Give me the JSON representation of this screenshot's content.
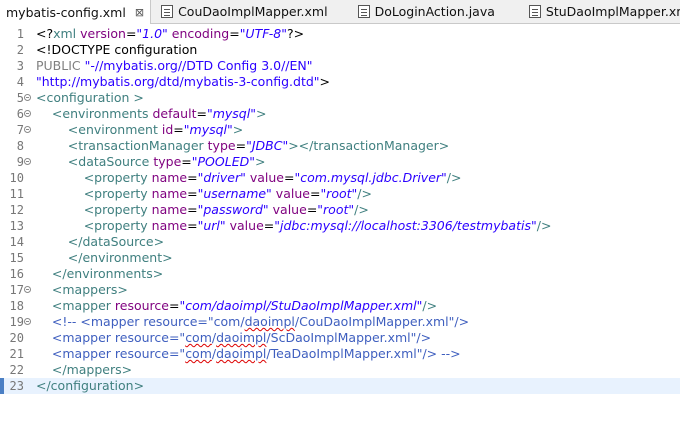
{
  "tabs": [
    {
      "label": "mybatis-config.xml",
      "close": "⊠",
      "active": true
    },
    {
      "label": "CouDaoImplMapper.xml"
    },
    {
      "label": "DoLoginAction.java"
    },
    {
      "label": "StuDaoImplMapper.xml"
    }
  ],
  "lines": [
    {
      "n": "1",
      "fold": false,
      "seg": [
        [
          "p",
          "<?"
        ],
        [
          "t",
          "xml"
        ],
        [
          "p",
          " "
        ],
        [
          "a",
          "version"
        ],
        [
          "p",
          "="
        ],
        [
          "v",
          "\"1.0\""
        ],
        [
          "p",
          " "
        ],
        [
          "a",
          "encoding"
        ],
        [
          "p",
          "="
        ],
        [
          "v",
          "\"UTF-8\""
        ],
        [
          "p",
          "?>"
        ]
      ]
    },
    {
      "n": "2",
      "fold": false,
      "seg": [
        [
          "p",
          "<!DOCTYPE configuration"
        ]
      ]
    },
    {
      "n": "3",
      "fold": false,
      "seg": [
        [
          "d",
          "PUBLIC "
        ],
        [
          "s",
          "\"-//mybatis.org//DTD Config 3.0//EN\""
        ]
      ]
    },
    {
      "n": "4",
      "fold": false,
      "seg": [
        [
          "s",
          "\"http://mybatis.org/dtd/mybatis-3-config.dtd\""
        ],
        [
          "p",
          ">"
        ]
      ]
    },
    {
      "n": "5",
      "fold": true,
      "seg": [
        [
          "t",
          "<configuration "
        ],
        [
          "t",
          ">"
        ]
      ]
    },
    {
      "n": "6",
      "fold": true,
      "seg": [
        [
          "p",
          "    "
        ],
        [
          "t",
          "<environments "
        ],
        [
          "a",
          "default"
        ],
        [
          "p",
          "="
        ],
        [
          "v",
          "\"mysql\""
        ],
        [
          "t",
          ">"
        ]
      ]
    },
    {
      "n": "7",
      "fold": true,
      "seg": [
        [
          "p",
          "        "
        ],
        [
          "t",
          "<environment "
        ],
        [
          "a",
          "id"
        ],
        [
          "p",
          "="
        ],
        [
          "v",
          "\"mysql\""
        ],
        [
          "t",
          ">"
        ]
      ]
    },
    {
      "n": "8",
      "fold": false,
      "seg": [
        [
          "p",
          "        "
        ],
        [
          "t",
          "<transactionManager "
        ],
        [
          "a",
          "type"
        ],
        [
          "p",
          "="
        ],
        [
          "v",
          "\"JDBC\""
        ],
        [
          "t",
          "></transactionManager>"
        ]
      ]
    },
    {
      "n": "9",
      "fold": true,
      "seg": [
        [
          "p",
          "        "
        ],
        [
          "t",
          "<dataSource "
        ],
        [
          "a",
          "type"
        ],
        [
          "p",
          "="
        ],
        [
          "v",
          "\"POOLED\""
        ],
        [
          "t",
          ">"
        ]
      ]
    },
    {
      "n": "10",
      "fold": false,
      "seg": [
        [
          "p",
          "            "
        ],
        [
          "t",
          "<property "
        ],
        [
          "a",
          "name"
        ],
        [
          "p",
          "="
        ],
        [
          "v",
          "\"driver\""
        ],
        [
          "p",
          " "
        ],
        [
          "a",
          "value"
        ],
        [
          "p",
          "="
        ],
        [
          "v",
          "\"com.mysql.jdbc.Driver\""
        ],
        [
          "t",
          "/>"
        ]
      ]
    },
    {
      "n": "11",
      "fold": false,
      "seg": [
        [
          "p",
          "            "
        ],
        [
          "t",
          "<property "
        ],
        [
          "a",
          "name"
        ],
        [
          "p",
          "="
        ],
        [
          "v",
          "\"username\""
        ],
        [
          "p",
          " "
        ],
        [
          "a",
          "value"
        ],
        [
          "p",
          "="
        ],
        [
          "v",
          "\"root\""
        ],
        [
          "t",
          "/>"
        ]
      ]
    },
    {
      "n": "12",
      "fold": false,
      "seg": [
        [
          "p",
          "            "
        ],
        [
          "t",
          "<property "
        ],
        [
          "a",
          "name"
        ],
        [
          "p",
          "="
        ],
        [
          "v",
          "\"password\""
        ],
        [
          "p",
          " "
        ],
        [
          "a",
          "value"
        ],
        [
          "p",
          "="
        ],
        [
          "v",
          "\"root\""
        ],
        [
          "t",
          "/>"
        ]
      ]
    },
    {
      "n": "13",
      "fold": false,
      "seg": [
        [
          "p",
          "            "
        ],
        [
          "t",
          "<property "
        ],
        [
          "a",
          "name"
        ],
        [
          "p",
          "="
        ],
        [
          "v",
          "\"url\""
        ],
        [
          "p",
          " "
        ],
        [
          "a",
          "value"
        ],
        [
          "p",
          "="
        ],
        [
          "v",
          "\"jdbc:mysql://localhost:3306/testmybatis\""
        ],
        [
          "t",
          "/>"
        ]
      ]
    },
    {
      "n": "14",
      "fold": false,
      "seg": [
        [
          "p",
          "        "
        ],
        [
          "t",
          "</dataSource>"
        ]
      ]
    },
    {
      "n": "15",
      "fold": false,
      "seg": [
        [
          "p",
          "        "
        ],
        [
          "t",
          "</environment>"
        ]
      ]
    },
    {
      "n": "16",
      "fold": false,
      "seg": [
        [
          "p",
          "    "
        ],
        [
          "t",
          "</environments>"
        ]
      ]
    },
    {
      "n": "17",
      "fold": true,
      "seg": [
        [
          "p",
          "    "
        ],
        [
          "t",
          "<mappers>"
        ]
      ]
    },
    {
      "n": "18",
      "fold": false,
      "seg": [
        [
          "p",
          "    "
        ],
        [
          "t",
          "<mapper "
        ],
        [
          "a",
          "resource"
        ],
        [
          "p",
          "="
        ],
        [
          "v",
          "\"com/daoimpl/StuDaoImplMapper.xml\""
        ],
        [
          "t",
          "/>"
        ]
      ]
    },
    {
      "n": "19",
      "fold": true,
      "seg": [
        [
          "p",
          "    "
        ],
        [
          "c",
          "<!-- <mapper resource=\"com/"
        ],
        [
          "ce",
          "daoimpl"
        ],
        [
          "c",
          "/CouDaoImplMapper.xml\"/>"
        ]
      ]
    },
    {
      "n": "20",
      "fold": false,
      "seg": [
        [
          "p",
          "    "
        ],
        [
          "c",
          "<mapper resource=\""
        ],
        [
          "ce",
          "com"
        ],
        [
          "c",
          "/"
        ],
        [
          "ce",
          "daoimpl"
        ],
        [
          "c",
          "/ScDaoImplMapper.xml\"/>"
        ]
      ]
    },
    {
      "n": "21",
      "fold": false,
      "seg": [
        [
          "p",
          "    "
        ],
        [
          "c",
          "<mapper resource=\""
        ],
        [
          "ce",
          "com"
        ],
        [
          "c",
          "/"
        ],
        [
          "ce",
          "daoimpl"
        ],
        [
          "c",
          "/TeaDaoImplMapper.xml\"/> -->"
        ]
      ]
    },
    {
      "n": "22",
      "fold": false,
      "seg": [
        [
          "p",
          "    "
        ],
        [
          "t",
          "</mappers>"
        ]
      ]
    },
    {
      "n": "23",
      "fold": false,
      "current": true,
      "seg": [
        [
          "t",
          "</configuration>"
        ]
      ]
    }
  ]
}
